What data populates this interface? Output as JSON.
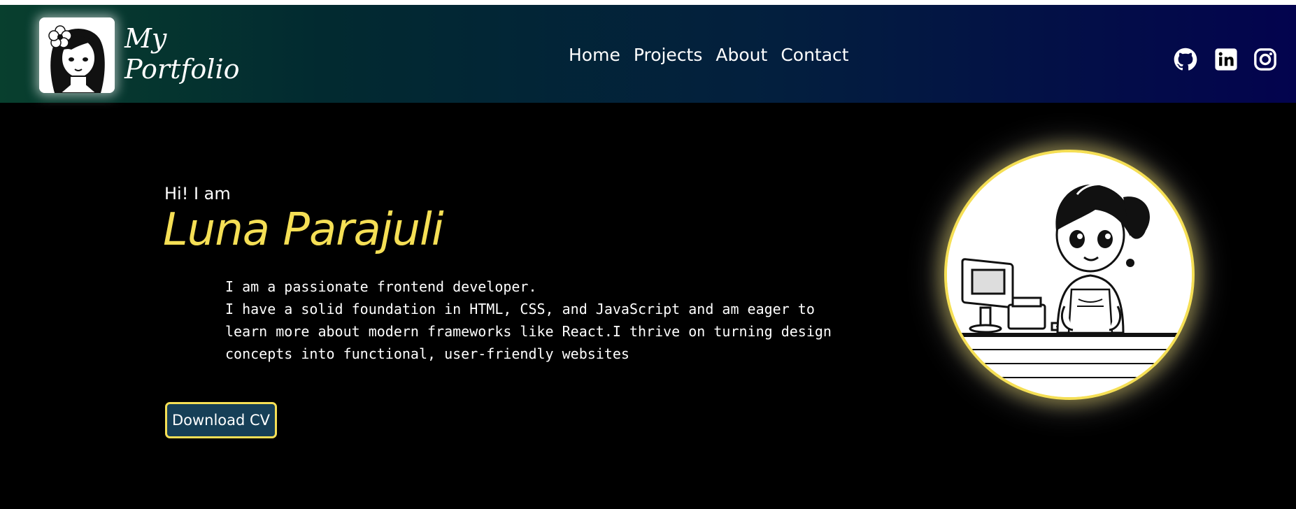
{
  "brand": {
    "line1": "My",
    "line2": "Portfolio",
    "logo_icon": "girl-with-flower-portrait-icon"
  },
  "nav": {
    "items": [
      "Home",
      "Projects",
      "About",
      "Contact"
    ]
  },
  "social": {
    "icons": [
      "github-icon",
      "linkedin-icon",
      "instagram-icon"
    ]
  },
  "hero": {
    "greeting": "Hi! I am",
    "name": "Luna Parajuli",
    "bio_lines": [
      "I am a passionate frontend developer.",
      "I have a solid foundation in HTML, CSS, and JavaScript and am eager to",
      "learn more about modern frameworks like React.I thrive on turning design",
      "concepts into functional, user-friendly websites"
    ],
    "cta_label": "Download CV",
    "avatar_icon": "girl-at-cashier-illustration"
  },
  "colors": {
    "accent": "#f5df55",
    "button_bg": "#163f57",
    "background": "#000000",
    "header_gradient_start": "#083f2e",
    "header_gradient_end": "#03034e"
  }
}
